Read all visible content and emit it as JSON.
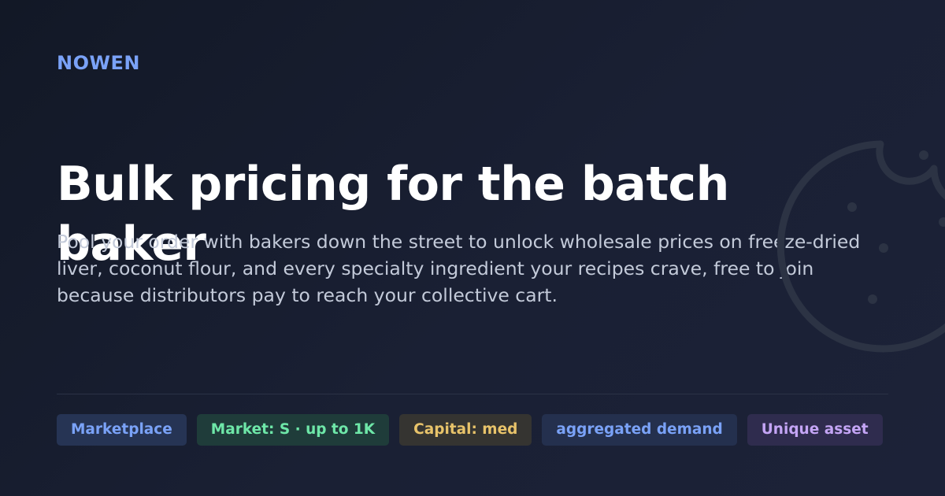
{
  "brand": "NOWEN",
  "headline": "Bulk pricing for the batch baker",
  "description": "Pool your order with bakers down the street to unlock wholesale prices on freeze-dried liver, coconut flour, and every specialty ingredient your recipes crave, free to join because distributors pay to reach your collective cart.",
  "tags": [
    {
      "label": "Marketplace",
      "color": "#7aa2f7"
    },
    {
      "label": "Market: S · up to 1K",
      "color": "#6ee7a8"
    },
    {
      "label": "Capital: med",
      "color": "#e8c36a"
    },
    {
      "label": "aggregated demand",
      "color": "#7aa2f7"
    },
    {
      "label": "Unique asset",
      "color": "#c4a5f5"
    }
  ],
  "decoration": {
    "icon": "cookie-icon"
  },
  "colors": {
    "background": "#161c2c",
    "accent": "#7aa2f7"
  }
}
